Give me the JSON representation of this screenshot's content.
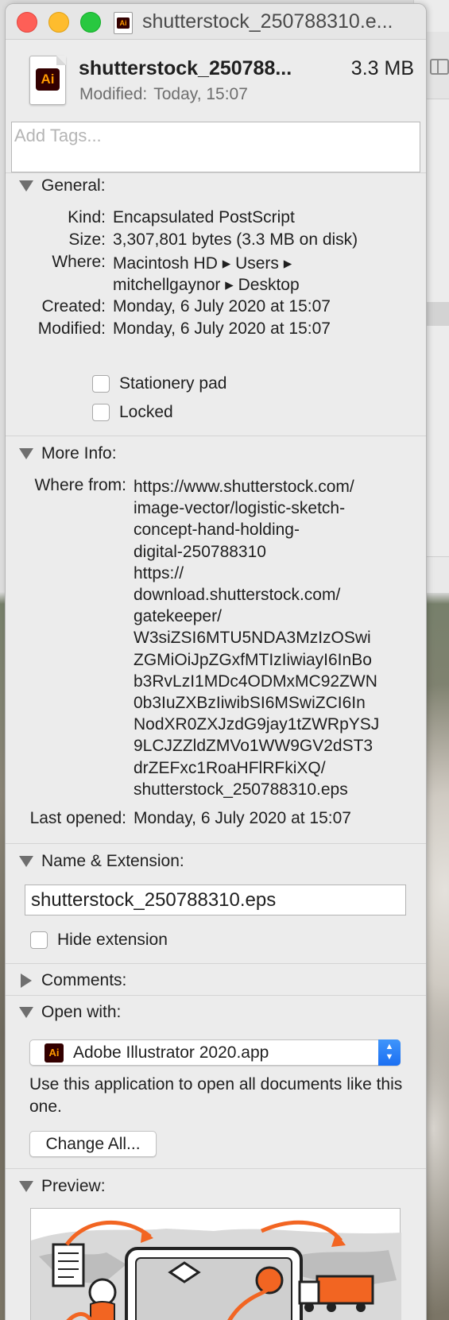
{
  "window": {
    "title": "shutterstock_250788310.e..."
  },
  "file": {
    "name": "shutterstock_250788...",
    "size": "3.3 MB",
    "modified_label": "Modified:",
    "modified_value": "Today, 15:07",
    "icon_badge": "Ai"
  },
  "tags": {
    "placeholder": "Add Tags..."
  },
  "general": {
    "title": "General:",
    "kind_label": "Kind:",
    "kind_value": "Encapsulated PostScript",
    "size_label": "Size:",
    "size_value": "3,307,801 bytes (3.3 MB on disk)",
    "where_label": "Where:",
    "where_line1": "Macintosh HD ▸ Users ▸",
    "where_line2": "mitchellgaynor ▸ Desktop",
    "created_label": "Created:",
    "created_value": "Monday, 6 July 2020 at 15:07",
    "modified_label": "Modified:",
    "modified_value": "Monday, 6 July 2020 at 15:07",
    "stationery_label": "Stationery pad",
    "stationery_checked": false,
    "locked_label": "Locked",
    "locked_checked": false
  },
  "more_info": {
    "title": "More Info:",
    "where_from_label": "Where from:",
    "where_from_lines": [
      "https://www.shutterstock.com/",
      "image-vector/logistic-sketch-",
      "concept-hand-holding-",
      "digital-250788310",
      "https://",
      "download.shutterstock.com/",
      "gatekeeper/",
      "W3siZSI6MTU5NDA3MzIzOSwi",
      "ZGMiOiJpZGxfMTIzIiwiayI6InBo",
      "b3RvLzI1MDc4ODMxMC92ZWN",
      "0b3IuZXBzIiwibSI6MSwiZCI6In",
      "NodXR0ZXJzdG9jay1tZWRpYSJ",
      "9LCJZZldZMVo1WW9GV2dST3",
      "drZEFxc1RoaHFlRFkiXQ/",
      "shutterstock_250788310.eps"
    ],
    "last_opened_label": "Last opened:",
    "last_opened_value": "Monday, 6 July 2020 at 15:07"
  },
  "name_extension": {
    "title": "Name & Extension:",
    "filename": "shutterstock_250788310.eps",
    "hide_extension_label": "Hide extension",
    "hide_extension_checked": false
  },
  "comments": {
    "title": "Comments:"
  },
  "open_with": {
    "title": "Open with:",
    "app_name": "Adobe Illustrator 2020.app",
    "app_badge": "Ai",
    "description": "Use this application to open all documents like this one.",
    "change_all_label": "Change All..."
  },
  "preview": {
    "title": "Preview:"
  },
  "colors": {
    "window_bg": "#ececec",
    "ai_badge_bg": "#330000",
    "ai_badge_fg": "#ff9a00",
    "accent_blue": "#1b6ff2",
    "preview_orange": "#f26522"
  },
  "icons": {
    "close": "close-button",
    "minimize": "minimize-button",
    "zoom": "zoom-button",
    "file": "illustrator-document-icon",
    "disclosure_open": "triangle-down-icon",
    "disclosure_closed": "triangle-right-icon",
    "popup_stepper": "chevron-up-down-icon"
  }
}
